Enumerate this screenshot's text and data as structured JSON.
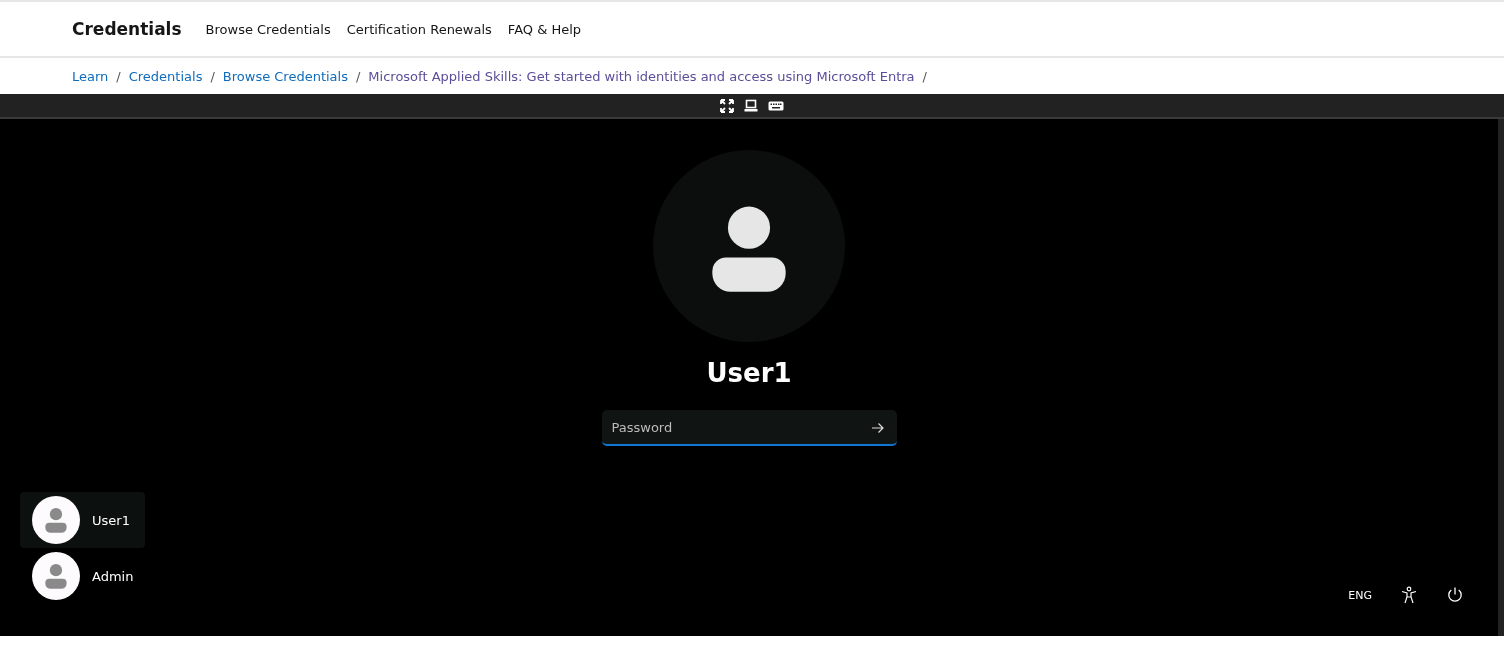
{
  "header": {
    "title": "Credentials",
    "nav": [
      "Browse Credentials",
      "Certification Renewals",
      "FAQ & Help"
    ]
  },
  "breadcrumbs": [
    {
      "label": "Learn",
      "visited": false
    },
    {
      "label": "Credentials",
      "visited": false
    },
    {
      "label": "Browse Credentials",
      "visited": false
    },
    {
      "label": "Microsoft Applied Skills: Get started with identities and access using Microsoft Entra",
      "visited": true
    }
  ],
  "breadcrumb_separator": "/",
  "lock_screen": {
    "user_name": "User1",
    "password": {
      "placeholder": "Password"
    },
    "users": [
      {
        "name": "User1",
        "selected": true
      },
      {
        "name": "Admin",
        "selected": false
      }
    ],
    "language": "ENG"
  }
}
